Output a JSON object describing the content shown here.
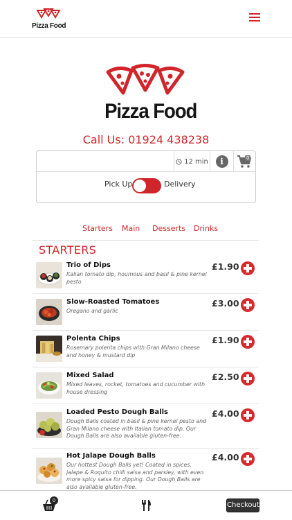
{
  "header": {
    "logo_text": "Pizza Food",
    "menu_icon": "hamburger-icon"
  },
  "hero": {
    "logo_text": "Pizza Food",
    "call_us": "Call Us: 01924 438238"
  },
  "order_options": {
    "time": "12 min",
    "cart_count": "0",
    "pickup_label": "Pick Up",
    "delivery_label": "Delivery",
    "mode_selected": "Pick Up"
  },
  "categories": [
    "Starters",
    "Main",
    "Desserts",
    "Drinks"
  ],
  "section": {
    "title": "STARTERS"
  },
  "items": [
    {
      "name": "Trio of Dips",
      "description": "Italian tomato dip, houmous and basil & pine kernel pesto",
      "price": "£1.90"
    },
    {
      "name": "Slow-Roasted Tomatoes",
      "description": "Oregano and garlic",
      "price": "£3.00"
    },
    {
      "name": "Polenta Chips",
      "description": "Rosemary polenta chips with Gran Milano cheese and honey & mustard dip",
      "price": "£1.90"
    },
    {
      "name": "Mixed Salad",
      "description": "Mixed leaves, rocket, tomatoes and cucumber with house dressing",
      "price": "£2.50"
    },
    {
      "name": "Loaded Pesto Dough Balls",
      "description": "Dough Balls coated in basil & pine kernel pesto and Gran Milano cheese with Italian tomato dip. Our Dough Balls are also available gluten-free.",
      "price": "£4.00"
    },
    {
      "name": "Hot Jalape Dough Balls",
      "description": "Our hottest Dough Balls yet! Coated in spices, jalape & Roquito chilli salsa and parsley, with even more spicy salsa for dipping. Our Dough Balls are also available gluten-free.",
      "price": "£4.00"
    }
  ],
  "bottom_bar": {
    "basket_count": "0",
    "checkout_label": "Checkout"
  },
  "colors": {
    "brand_red": "#d0262b",
    "text_dark": "#222222"
  }
}
